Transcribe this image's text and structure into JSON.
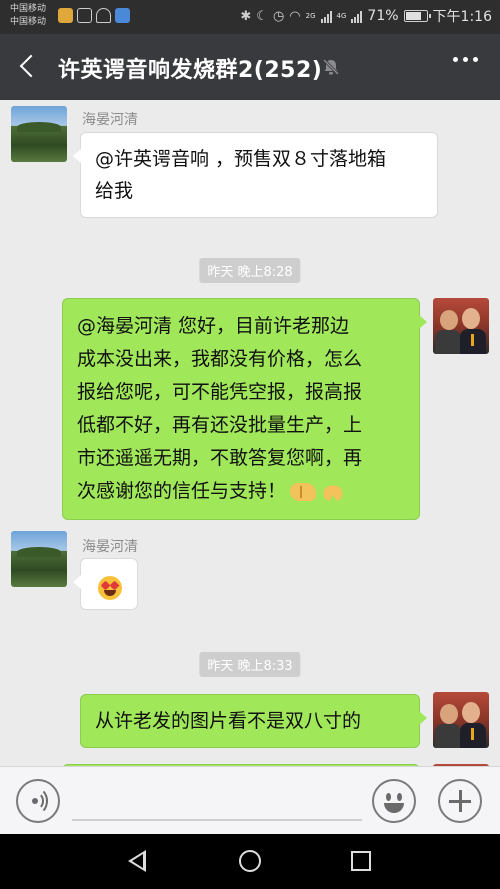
{
  "status_bar": {
    "carrier_1": "中国移动",
    "carrier_2": "中国移动",
    "battery_text": "71%",
    "battery_level": 0.71,
    "time": "下午1:16",
    "net_1": "2G",
    "net_2": "4G"
  },
  "header": {
    "title": "许英谔音响发烧群2(252)",
    "mute_icon": "bell-off-icon",
    "more_icon": "more-dots-icon"
  },
  "messages": [
    {
      "side": "left",
      "sender": "海晏河清",
      "text_1": "@许英谔音响 ，预售双８寸落地箱",
      "text_2": "给我"
    },
    {
      "type": "time",
      "text": "昨天 晚上8:28"
    },
    {
      "side": "right",
      "lines": [
        "@海晏河清  您好，目前许老那边",
        "成本没出来，我都没有价格，怎么",
        "报给您呢，可不能凭空报，报高报",
        "低都不好，再有还没批量生产，上",
        "市还遥遥无期，不敢答复您啊，再",
        "次感谢您的信任与支持！"
      ],
      "emojis": [
        "handshake-emoji",
        "pray-emoji"
      ]
    },
    {
      "side": "left",
      "sender": "海晏河清",
      "emoji": "heart-eyes-emoji"
    },
    {
      "type": "time",
      "text": "昨天 晚上8:33"
    },
    {
      "side": "right",
      "text": "从许老发的图片看不是双八寸的"
    }
  ],
  "input_bar": {
    "voice_icon": "voice-icon",
    "emoji_icon": "emoji-icon",
    "plus_icon": "plus-icon"
  },
  "nav": {
    "back_icon": "nav-back-icon",
    "home_icon": "nav-home-icon",
    "recent_icon": "nav-recent-icon"
  },
  "colors": {
    "titlebar": "#393a3e",
    "bubble_self": "#a0e75a",
    "bubble_other": "#ffffff",
    "background": "#ebebeb"
  }
}
